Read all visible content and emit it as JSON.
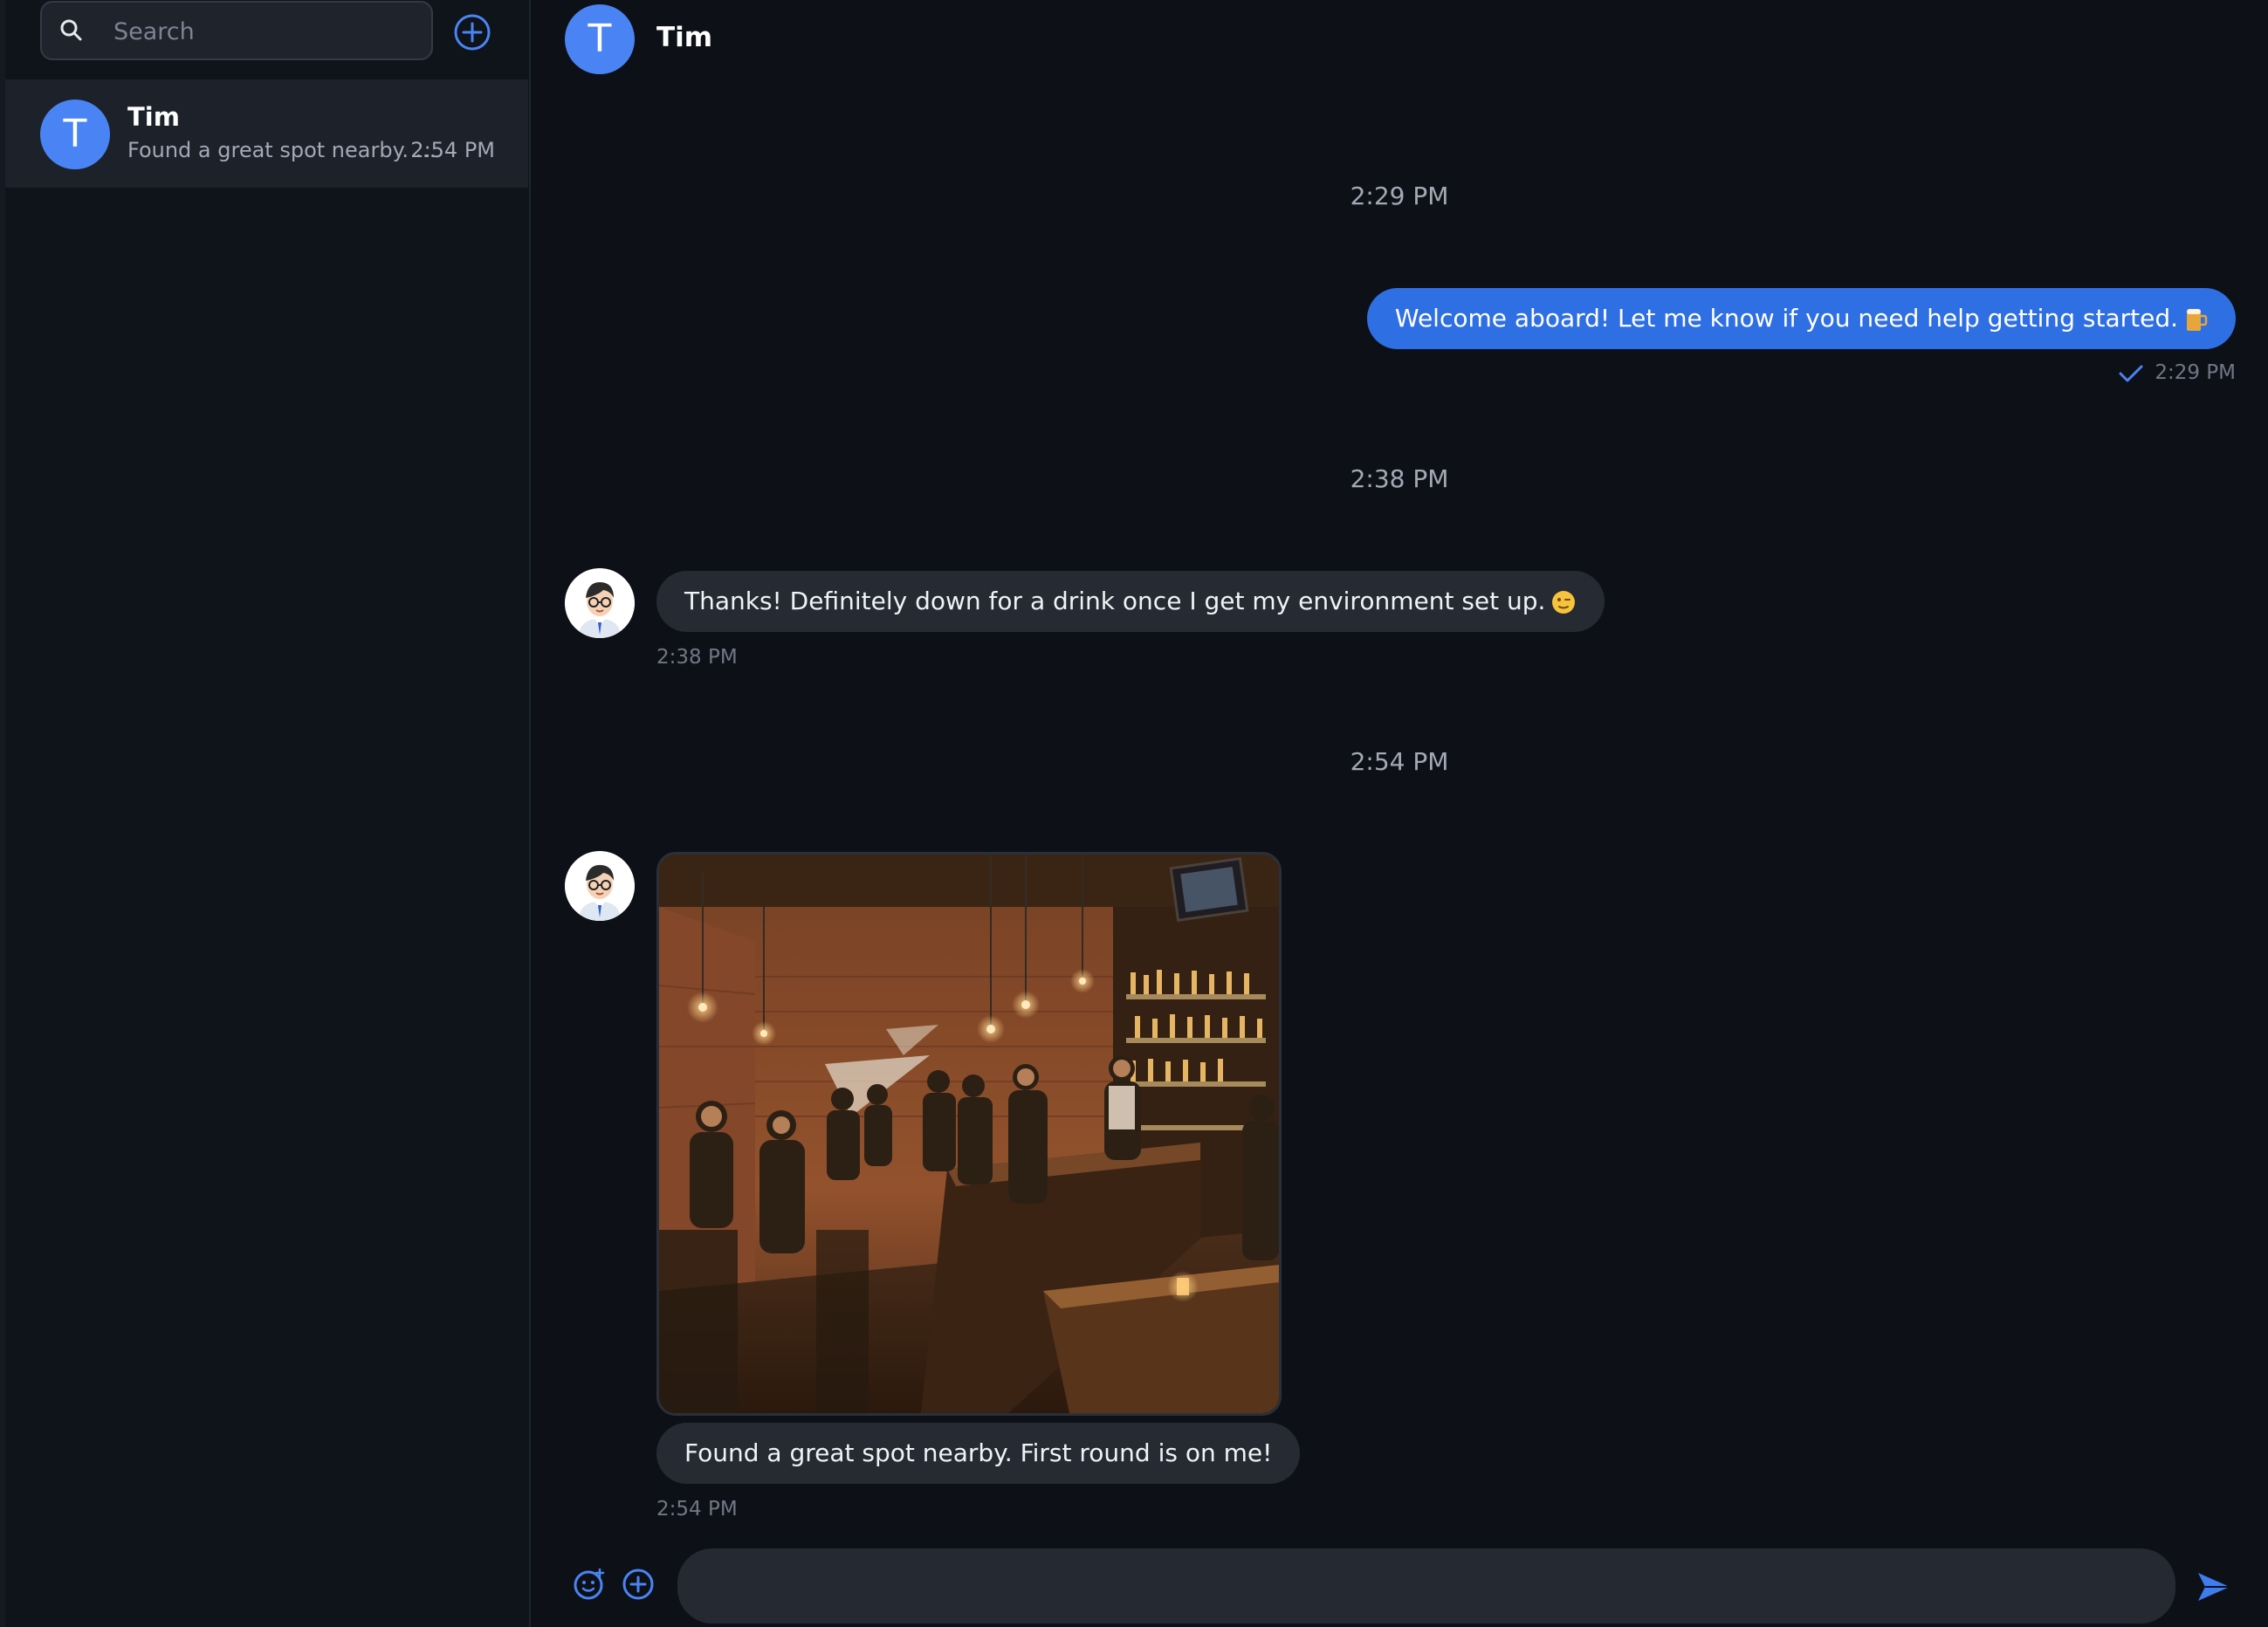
{
  "sidebar": {
    "search": {
      "placeholder": "Search",
      "value": ""
    },
    "conversations": [
      {
        "initial": "T",
        "name": "Tim",
        "preview": "Found a great spot nearby. …",
        "time": "2:54 PM"
      }
    ]
  },
  "chat": {
    "header": {
      "initial": "T",
      "name": "Tim"
    },
    "timestamps": [
      "2:29 PM",
      "2:38 PM",
      "2:54 PM"
    ],
    "messages": [
      {
        "direction": "outgoing",
        "text": "Welcome aboard! Let me know if you need help getting started.",
        "emoji": "beer-mug",
        "time": "2:29 PM",
        "status": "sent"
      },
      {
        "direction": "incoming",
        "text": "Thanks! Definitely down for a drink once I get my environment set up.",
        "emoji": "winking-face",
        "time": "2:38 PM"
      },
      {
        "direction": "incoming",
        "image": "bar-interior-photo",
        "text": "Found a great spot nearby. First round is on me!",
        "time": "2:54 PM"
      }
    ]
  },
  "composer": {
    "placeholder": "",
    "value": ""
  },
  "colors": {
    "background": "#0d1117",
    "sidebar": "#0f131a",
    "accent": "#4a84f4",
    "outgoing_bubble": "#2f6fe4",
    "incoming_bubble": "#262b33"
  },
  "icons": [
    "search-icon",
    "plus-circle-icon",
    "checkmark-icon",
    "emoji-add-icon",
    "send-icon"
  ]
}
